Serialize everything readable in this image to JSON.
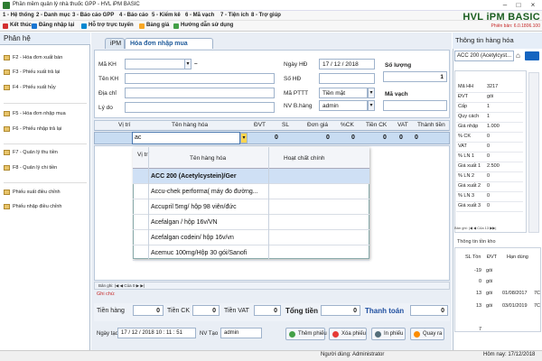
{
  "window": {
    "title": "Phần mềm quản lý nhà thuốc GPP - HVL iPM BASIC"
  },
  "menu": [
    "1 - Hệ thống",
    "2 - Danh mục",
    "3 - Báo cáo GPP",
    "4 - Báo cáo",
    "5 - Kiểm kê",
    "6 - Mã vạch",
    "7 - Tiện ích",
    "8 - Trợ giúp"
  ],
  "toolbar": [
    "Kết thúc",
    "Đăng nhập lại",
    "Hỗ trợ trực tuyến",
    "Bảng giá",
    "Hướng dẫn sử dụng"
  ],
  "logo": {
    "brand": "HVL",
    "product": "iPM BASIC",
    "version": "Phiên bản: 6.0.1806.100"
  },
  "left": {
    "title": "Phân hệ",
    "items": [
      "F2 - Hóa đơn xuất bán",
      "F3 - Phiếu xuất trả lại",
      "F4 - Phiếu xuất hủy",
      "F5 - Hóa đơn nhập mua",
      "F6 - Phiếu nhập trả lại",
      "F7 - Quản lý thu tiền",
      "F8 - Quản lý chi tiền",
      "Phiếu xuất điều chỉnh",
      "Phiếu nhập điều chỉnh"
    ]
  },
  "tabs": {
    "ipm": "iPM",
    "active": "Hóa đơn nhập mua"
  },
  "form": {
    "ma_kh": "Mã KH",
    "ten_kh": "Tên KH",
    "dia_chi": "Địa chỉ",
    "ly_do": "Lý do",
    "ngay_hd": "Ngày HĐ",
    "ngay_hd_val": "17 / 12 / 2018",
    "so_hd": "Số HĐ",
    "ma_pttt": "Mã PTTT",
    "ma_pttt_val": "Tiền mặt",
    "nv_bh": "NV B.hàng",
    "nv_bh_val": "admin",
    "so_luong": "Số lượng",
    "so_luong_val": "1",
    "ma_vach": "Mã vạch",
    "dash": "–"
  },
  "grid": {
    "headers": [
      "Vị trí",
      "Tên hàng hóa",
      "ĐVT",
      "SL",
      "Đơn giá",
      "%CK",
      "Tiền CK",
      "VAT",
      "Thành tiền"
    ],
    "input": "ac",
    "zeros": [
      "0",
      "0",
      "0",
      "0",
      "0",
      "0"
    ]
  },
  "dropdown": {
    "h_vitri": "Vị trí",
    "h_ten": "Tên hàng hóa",
    "h_hoatchat": "Hoạt chất chính",
    "rows": [
      "ACC 200 (Acetylcystein)/Ger",
      "Accu-chek performa( máy đo đường...",
      "Accupril 5mg/ hộp 98 viên/đức",
      "Acefalgan / hộp 16v/VN",
      "Acefalgan codein/ hộp 16v/vn",
      "Acemuc 100mg/Hộp 30 gói/Sanofi"
    ]
  },
  "pager": "Bản ghi: |◀ ◀ Của 0 ▶ ▶|",
  "ghichu": "Ghi chú:",
  "totals": {
    "tien_hang": "Tiền hàng",
    "ck": "Tiền CK",
    "vat": "Tiền VAT",
    "tong": "Tổng tiền",
    "tt": "Thanh toán",
    "v": "0"
  },
  "footer": {
    "ngay_tao": "Ngày tạo",
    "ngay_tao_val": "17 / 12 / 2018   10 : 11 : 51",
    "nv_tao": "NV Tạo",
    "nv_tao_val": "admin",
    "btns": [
      "Thêm phiếu",
      "Xóa phiếu",
      "In phiếu",
      "Quay ra"
    ]
  },
  "right": {
    "title": "Thông tin hàng hóa",
    "search": "ACC 200 (Acetylcyst...",
    "code": "3217",
    "info": [
      [
        "Mã HH",
        "3217"
      ],
      [
        "ĐVT",
        "gói"
      ],
      [
        "Cấp",
        "1"
      ],
      [
        "Quy cách",
        "1"
      ],
      [
        "Giá nhập",
        "1.000"
      ],
      [
        "% CK",
        "0"
      ],
      [
        "VAT",
        "0"
      ],
      [
        "% LN 1",
        "0"
      ],
      [
        "Giá xuất 1",
        "2.500"
      ],
      [
        "% LN 2",
        "0"
      ],
      [
        "Giá xuất 2",
        "0"
      ],
      [
        "% LN 3",
        "0"
      ],
      [
        "Giá xuất 3",
        "0"
      ]
    ],
    "pager": "Bản ghi: |◀ ◀ Của 13 ▶▶|",
    "stock_title": "Thông tin tồn kho",
    "stock_head": [
      "SL Tồn",
      "ĐVT",
      "Hạn dùng"
    ],
    "stock": [
      [
        "-19",
        "gói",
        ""
      ],
      [
        "0",
        "gói",
        ""
      ],
      [
        "13",
        "gói",
        "01/08/2017"
      ],
      [
        "13",
        "gói",
        "03/01/2019"
      ]
    ],
    "stock_extra": [
      "7C",
      "7C"
    ],
    "stock_total": "7"
  },
  "status": {
    "user": "Người dùng: Administrator",
    "date": "Hôm nay: 17/12/2018"
  }
}
